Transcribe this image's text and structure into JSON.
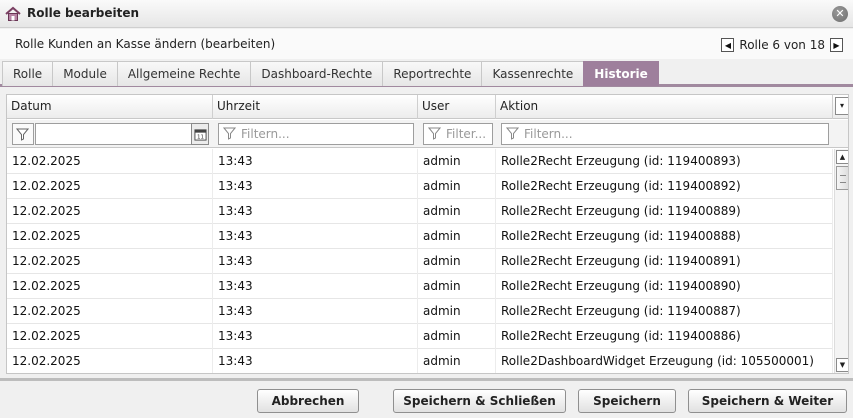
{
  "window": {
    "title": "Rolle bearbeiten",
    "app_icon": "house-icon",
    "close_icon": "close-icon"
  },
  "subheader": {
    "title": "Rolle Kunden an Kasse ändern (bearbeiten)",
    "pager_label": "Rolle 6 von 18"
  },
  "tabs": [
    {
      "label": "Rolle",
      "active": false
    },
    {
      "label": "Module",
      "active": false
    },
    {
      "label": "Allgemeine Rechte",
      "active": false
    },
    {
      "label": "Dashboard-Rechte",
      "active": false
    },
    {
      "label": "Reportrechte",
      "active": false
    },
    {
      "label": "Kassenrechte",
      "active": false
    },
    {
      "label": "Historie",
      "active": true
    }
  ],
  "grid": {
    "columns": [
      "Datum",
      "Uhrzeit",
      "User",
      "Aktion"
    ],
    "filter_placeholder": "Filtern...",
    "filter_placeholder_short": "Filter...",
    "rows": [
      [
        "12.02.2025",
        "13:43",
        "admin",
        "Rolle2Recht Erzeugung (id: 119400893)"
      ],
      [
        "12.02.2025",
        "13:43",
        "admin",
        "Rolle2Recht Erzeugung (id: 119400892)"
      ],
      [
        "12.02.2025",
        "13:43",
        "admin",
        "Rolle2Recht Erzeugung (id: 119400889)"
      ],
      [
        "12.02.2025",
        "13:43",
        "admin",
        "Rolle2Recht Erzeugung (id: 119400888)"
      ],
      [
        "12.02.2025",
        "13:43",
        "admin",
        "Rolle2Recht Erzeugung (id: 119400891)"
      ],
      [
        "12.02.2025",
        "13:43",
        "admin",
        "Rolle2Recht Erzeugung (id: 119400890)"
      ],
      [
        "12.02.2025",
        "13:43",
        "admin",
        "Rolle2Recht Erzeugung (id: 119400887)"
      ],
      [
        "12.02.2025",
        "13:43",
        "admin",
        "Rolle2Recht Erzeugung (id: 119400886)"
      ],
      [
        "12.02.2025",
        "13:43",
        "admin",
        "Rolle2DashboardWidget Erzeugung (id: 105500001)"
      ]
    ]
  },
  "footer": {
    "cancel_label": "Abbrechen",
    "save_close_label": "Speichern & Schließen",
    "save_label": "Speichern",
    "save_next_label": "Speichern & Weiter"
  },
  "colors": {
    "active_tab": "#9e7f9c",
    "tab_strip_border": "#a1899f"
  }
}
